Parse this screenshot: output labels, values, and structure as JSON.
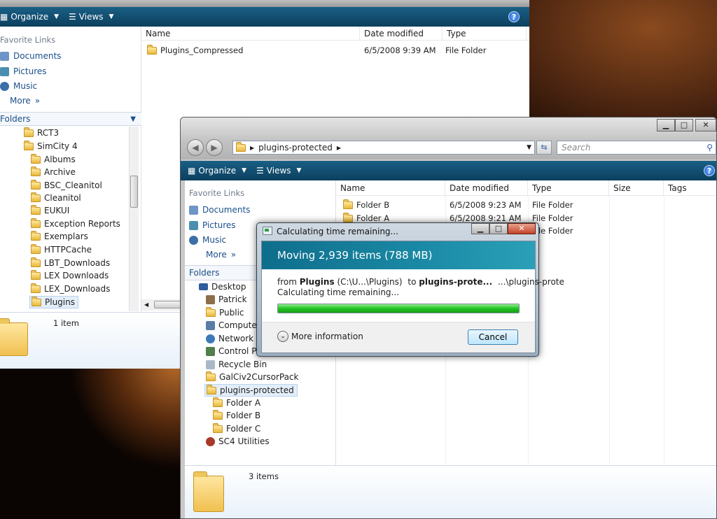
{
  "back_window": {
    "toolbar": {
      "organize": "Organize",
      "views": "Views",
      "help": "?"
    },
    "favorite_links_title": "Favorite Links",
    "favorite_links": [
      "Documents",
      "Pictures",
      "Music"
    ],
    "more": "More",
    "folders_title": "Folders",
    "tree": [
      "RCT3",
      "SimCity 4",
      "Albums",
      "Archive",
      "BSC_Cleanitol",
      "Cleanitol",
      "EUKUI",
      "Exception Reports",
      "Exemplars",
      "HTTPCache",
      "LBT_Downloads",
      "LEX Downloads",
      "LEX_Downloads",
      "Plugins"
    ],
    "columns": {
      "name": "Name",
      "date": "Date modified",
      "type": "Type"
    },
    "rows": [
      {
        "name": "Plugins_Compressed",
        "date": "6/5/2008 9:39 AM",
        "type": "File Folder"
      }
    ],
    "status": "1 item"
  },
  "front_window": {
    "address": {
      "path": "plugins-protected",
      "search_placeholder": "Search"
    },
    "toolbar": {
      "organize": "Organize",
      "views": "Views",
      "help": "?"
    },
    "favorite_links_title": "Favorite Links",
    "favorite_links": [
      "Documents",
      "Pictures",
      "Music"
    ],
    "more": "More",
    "folders_title": "Folders",
    "tree": [
      "Desktop",
      "Patrick",
      "Public",
      "Computer",
      "Network",
      "Control Pa",
      "Recycle Bin",
      "GalCiv2CursorPack",
      "plugins-protected",
      "Folder A",
      "Folder B",
      "Folder C",
      "SC4 Utilities"
    ],
    "columns": {
      "name": "Name",
      "date": "Date modified",
      "type": "Type",
      "size": "Size",
      "tags": "Tags"
    },
    "rows": [
      {
        "name": "Folder B",
        "date": "6/5/2008 9:23 AM",
        "type": "File Folder"
      },
      {
        "name": "Folder A",
        "date": "6/5/2008 9:21 AM",
        "type": "File Folder"
      },
      {
        "name": "",
        "date": "",
        "type": "File Folder"
      }
    ],
    "status": "3 items"
  },
  "dialog": {
    "title": "Calculating time remaining...",
    "heading": "Moving 2,939 items (788 MB)",
    "from_label": "from",
    "from_name": "Plugins",
    "from_path": "(C:\\U...\\Plugins)",
    "to_label": "to",
    "to_name": "plugins-prote...",
    "to_path": "...\\plugins-prote",
    "status": "Calculating time remaining...",
    "progress_fraction": 1.0,
    "more_info": "More information",
    "cancel": "Cancel"
  }
}
